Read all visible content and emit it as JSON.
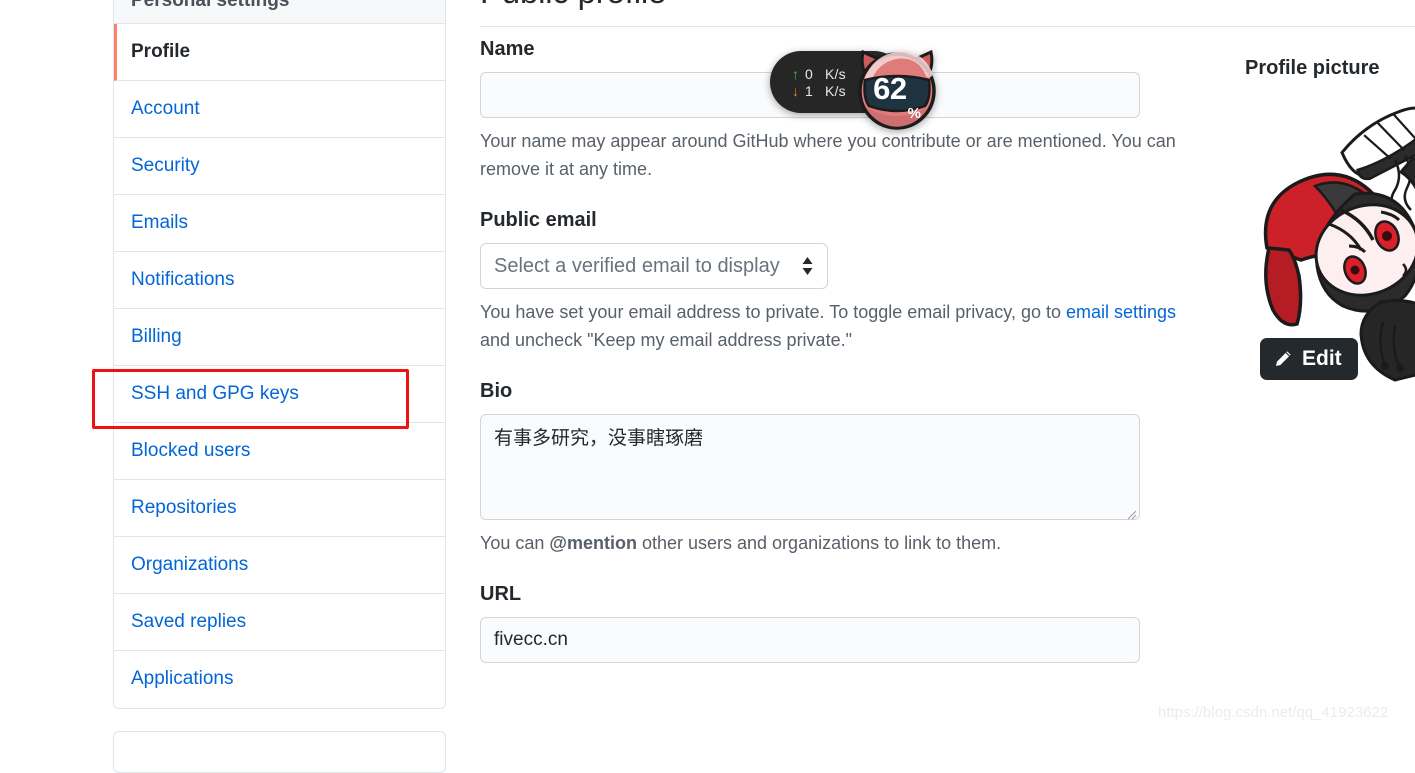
{
  "sidebar": {
    "header": "Personal settings",
    "items": [
      {
        "label": "Profile",
        "selected": true
      },
      {
        "label": "Account",
        "selected": false
      },
      {
        "label": "Security",
        "selected": false
      },
      {
        "label": "Emails",
        "selected": false
      },
      {
        "label": "Notifications",
        "selected": false
      },
      {
        "label": "Billing",
        "selected": false
      },
      {
        "label": "SSH and GPG keys",
        "selected": false
      },
      {
        "label": "Blocked users",
        "selected": false
      },
      {
        "label": "Repositories",
        "selected": false
      },
      {
        "label": "Organizations",
        "selected": false
      },
      {
        "label": "Saved replies",
        "selected": false
      },
      {
        "label": "Applications",
        "selected": false
      }
    ],
    "highlight_label": "SSH and GPG keys",
    "highlight_color": "#ee1111",
    "selected_accent_color": "#f9826c"
  },
  "main": {
    "title": "Public profile",
    "name": {
      "label": "Name",
      "value": "",
      "placeholder": "",
      "help": "Your name may appear around GitHub where you contribute or are mentioned. You can remove it at any time."
    },
    "public_email": {
      "label": "Public email",
      "selected_option": "Select a verified email to display",
      "options": [
        "Select a verified email to display"
      ],
      "help_prefix": "You have set your email address to private. To toggle email privacy, go to ",
      "help_link": "email settings",
      "help_suffix": " and uncheck \"Keep my email address private.\""
    },
    "bio": {
      "label": "Bio",
      "value": "有事多研究，没事瞎琢磨",
      "help_prefix": "You can ",
      "help_mention": "@mention",
      "help_suffix": " other users and organizations to link to them."
    },
    "url": {
      "label": "URL",
      "value": "fivecc.cn"
    }
  },
  "profile_picture": {
    "title": "Profile picture",
    "edit_label": "Edit",
    "edit_icon": "pencil-icon"
  },
  "network_widget": {
    "upload_arrow": "↑",
    "upload_value": "0",
    "upload_unit": "K/s",
    "download_arrow": "↓",
    "download_value": "1",
    "download_unit": "K/s",
    "percent_value": "62",
    "percent_symbol": "%",
    "upload_color": "#3fbf4f",
    "download_color": "#e08a1e",
    "badge_color": "#e06a6a",
    "pill_color": "#262626"
  },
  "watermark": {
    "text": "https://blog.csdn.net/qq_41923622"
  }
}
